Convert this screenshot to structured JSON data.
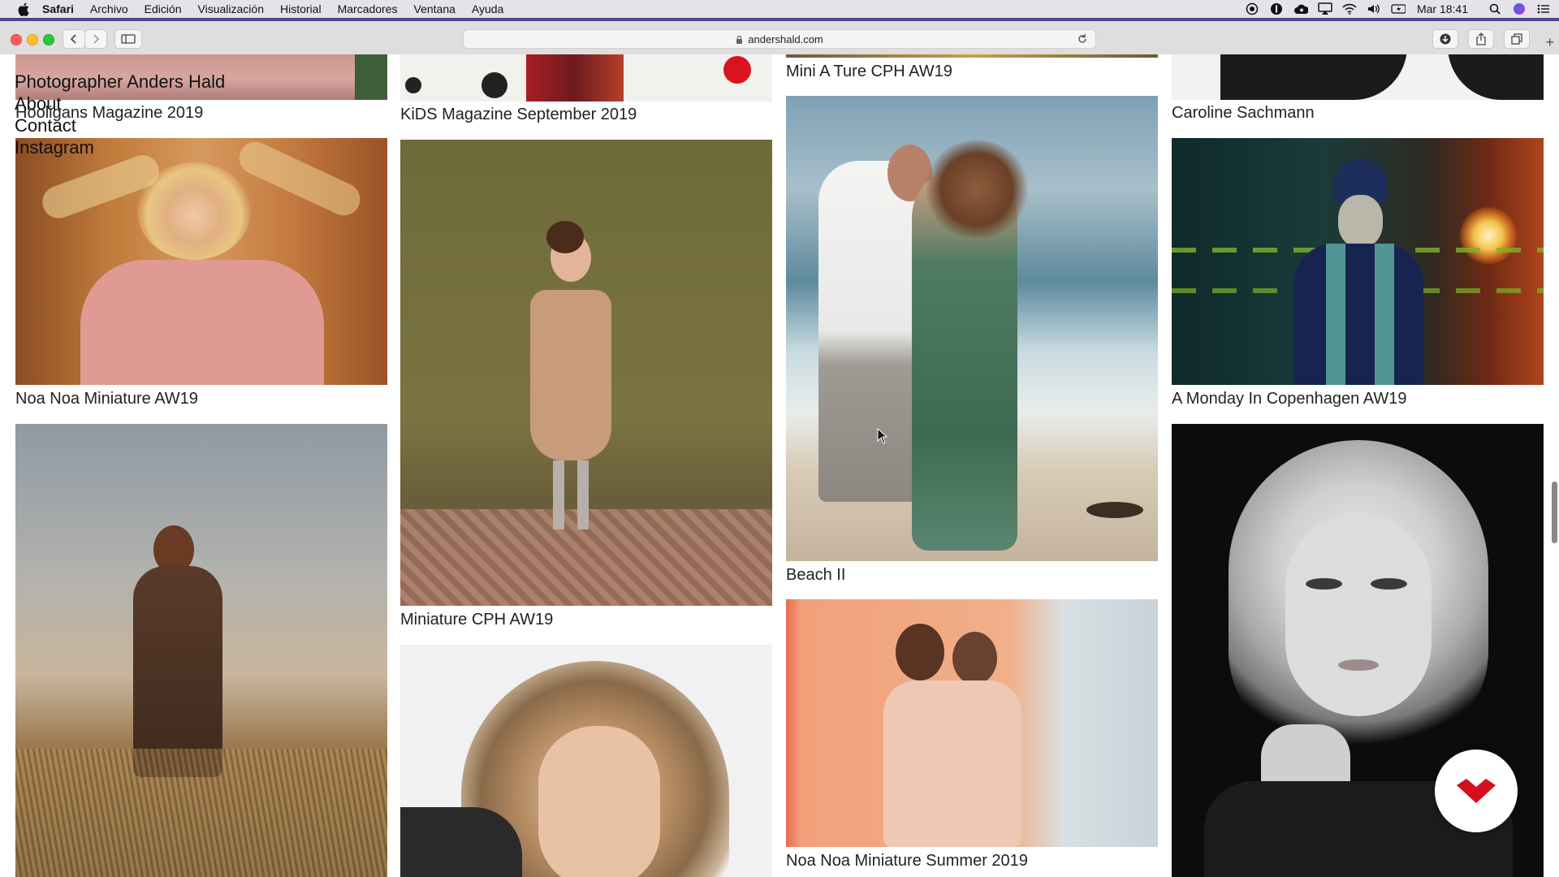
{
  "menubar": {
    "app": "Safari",
    "items": [
      "Archivo",
      "Edición",
      "Visualización",
      "Historial",
      "Marcadores",
      "Ventana",
      "Ayuda"
    ],
    "clock": "Mar 18:41"
  },
  "browser": {
    "url": "andershald.com"
  },
  "site": {
    "nav": [
      "Photographer Anders Hald",
      "About",
      "Contact",
      "Instagram"
    ]
  },
  "gallery": {
    "captions": {
      "hooligans": "Hooligans Magazine 2019",
      "kids_mag": "KiDS Magazine September 2019",
      "mini_a_ture": "Mini A Ture CPH AW19",
      "caroline": "Caroline Sachmann",
      "noa_noa_aw19": "Noa Noa Miniature AW19",
      "miniature_cph": "Miniature CPH AW19",
      "beach": "Beach II",
      "monday_cph": "A Monday In Copenhagen AW19",
      "noa_noa_summer": "Noa Noa Miniature Summer 2019"
    }
  },
  "colors": {
    "accent": "#4a4a8a",
    "fab_logo": "#d4101e"
  }
}
